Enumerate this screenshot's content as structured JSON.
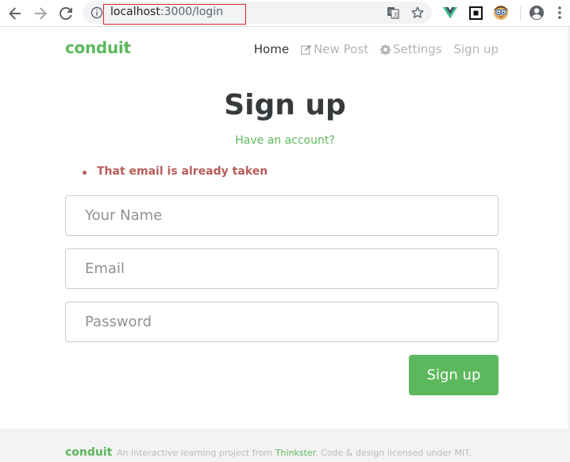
{
  "browser": {
    "url_host": "localhost",
    "url_rest": ":3000/login",
    "icons": [
      "back-arrow-icon",
      "forward-arrow-icon",
      "reload-icon",
      "info-icon",
      "translate-icon",
      "bookmark-star-icon",
      "vue-devtools-icon",
      "qr-code-icon",
      "extension-face-icon",
      "account-icon",
      "menu-kebab-icon"
    ]
  },
  "navbar": {
    "brand": "conduit",
    "links": [
      {
        "label": "Home",
        "active": true
      },
      {
        "label": "New Post",
        "icon": "compose-icon"
      },
      {
        "label": "Settings",
        "icon": "gear-icon"
      },
      {
        "label": "Sign up"
      }
    ]
  },
  "auth": {
    "title": "Sign up",
    "switch_link": "Have an account?",
    "errors": [
      "That email is already taken"
    ],
    "fields": {
      "name_placeholder": "Your Name",
      "email_placeholder": "Email",
      "password_placeholder": "Password"
    },
    "submit_label": "Sign up"
  },
  "footer": {
    "brand": "conduit",
    "text_before": "An interactive learning project from ",
    "link": "Thinkster",
    "text_after": ". Code & design licensed under MIT."
  },
  "colors": {
    "brand": "#5cb85c",
    "error": "#b85c5c",
    "url_highlight_border": "#e0252b"
  }
}
